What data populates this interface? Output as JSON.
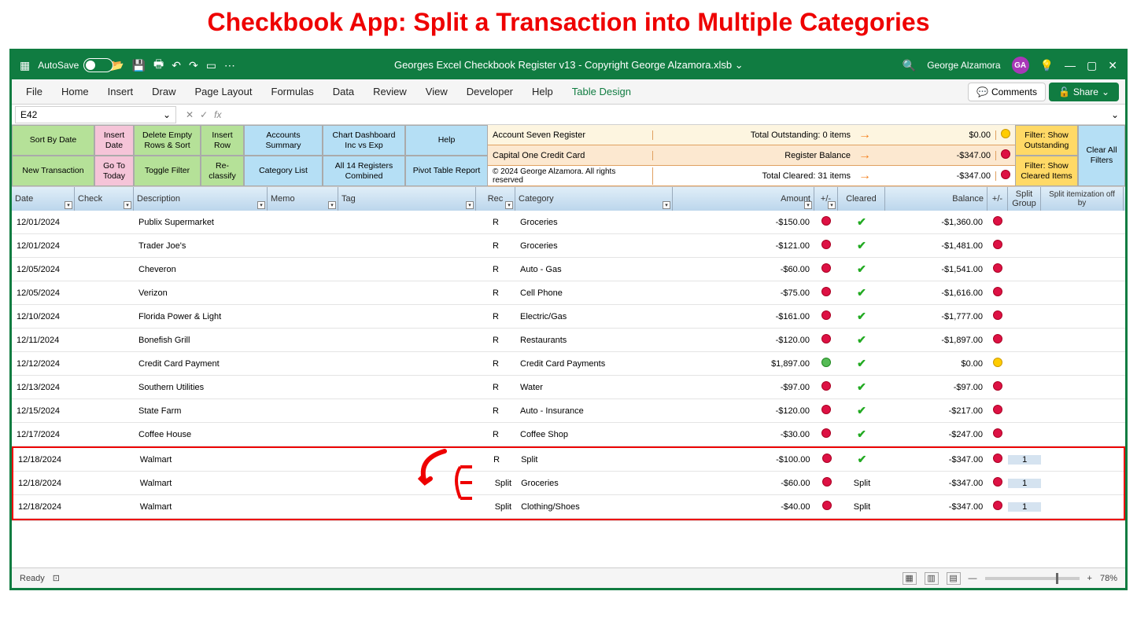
{
  "pageTitle": "Checkbook App: Split a Transaction into Multiple Categories",
  "autoSave": {
    "label": "AutoSave",
    "state": "Off"
  },
  "fileTitle": "Georges Excel Checkbook Register v13 - Copyright George Alzamora.xlsb",
  "user": {
    "name": "George Alzamora",
    "initials": "GA"
  },
  "ribbonTabs": [
    "File",
    "Home",
    "Insert",
    "Draw",
    "Page Layout",
    "Formulas",
    "Data",
    "Review",
    "View",
    "Developer",
    "Help",
    "Table Design"
  ],
  "activeTab": "Table Design",
  "commentsLabel": "Comments",
  "shareLabel": "Share",
  "nameBox": "E42",
  "toolbar": {
    "sortByDate": "Sort By Date",
    "insertDate": "Insert Date",
    "deleteEmpty": "Delete Empty Rows & Sort",
    "insertRow": "Insert Row",
    "accountsSummary": "Accounts Summary",
    "chartDashboard": "Chart Dashboard Inc vs Exp",
    "help": "Help",
    "newTransaction": "New Transaction",
    "goToToday": "Go To Today",
    "toggleFilter": "Toggle Filter",
    "reclassify": "Re-classify",
    "categoryList": "Category List",
    "allRegisters": "All 14 Registers Combined",
    "pivotTable": "Pivot Table Report",
    "filterOutstanding": "Filter: Show Outstanding",
    "filterCleared": "Filter: Show Cleared Items",
    "clearFilters": "Clear All Filters"
  },
  "summary": {
    "row1": {
      "labelA": "Account Seven Register",
      "labelB": "Total Outstanding: 0 items",
      "amount": "$0.00"
    },
    "row2": {
      "labelA": "Capital One Credit Card",
      "labelB": "Register Balance",
      "amount": "-$347.00"
    },
    "row3": {
      "labelA": "© 2024 George Alzamora. All rights reserved",
      "labelB": "Total Cleared: 31 items",
      "amount": "-$347.00"
    }
  },
  "headers": {
    "date": "Date",
    "check": "Check",
    "description": "Description",
    "memo": "Memo",
    "tag": "Tag",
    "rec": "Rec",
    "category": "Category",
    "amount": "Amount",
    "pm": "+/-",
    "cleared": "Cleared",
    "balance": "Balance",
    "pm2": "+/-",
    "splitGroup": "Split Group",
    "splitOff": "Split itemization off by"
  },
  "rows": [
    {
      "date": "12/01/2024",
      "desc": "Publix Supermarket",
      "rec": "R",
      "cat": "Groceries",
      "amount": "-$150.00",
      "pm": "red",
      "cleared": "check",
      "balance": "-$1,360.00",
      "pm2": "red",
      "split": "",
      "hl": false
    },
    {
      "date": "12/01/2024",
      "desc": "Trader Joe's",
      "rec": "R",
      "cat": "Groceries",
      "amount": "-$121.00",
      "pm": "red",
      "cleared": "check",
      "balance": "-$1,481.00",
      "pm2": "red",
      "split": "",
      "hl": false
    },
    {
      "date": "12/05/2024",
      "desc": "Cheveron",
      "rec": "R",
      "cat": "Auto - Gas",
      "amount": "-$60.00",
      "pm": "red",
      "cleared": "check",
      "balance": "-$1,541.00",
      "pm2": "red",
      "split": "",
      "hl": false
    },
    {
      "date": "12/05/2024",
      "desc": "Verizon",
      "rec": "R",
      "cat": "Cell Phone",
      "amount": "-$75.00",
      "pm": "red",
      "cleared": "check",
      "balance": "-$1,616.00",
      "pm2": "red",
      "split": "",
      "hl": false
    },
    {
      "date": "12/10/2024",
      "desc": "Florida Power & Light",
      "rec": "R",
      "cat": "Electric/Gas",
      "amount": "-$161.00",
      "pm": "red",
      "cleared": "check",
      "balance": "-$1,777.00",
      "pm2": "red",
      "split": "",
      "hl": false
    },
    {
      "date": "12/11/2024",
      "desc": "Bonefish Grill",
      "rec": "R",
      "cat": "Restaurants",
      "amount": "-$120.00",
      "pm": "red",
      "cleared": "check",
      "balance": "-$1,897.00",
      "pm2": "red",
      "split": "",
      "hl": false
    },
    {
      "date": "12/12/2024",
      "desc": "Credit Card Payment",
      "rec": "R",
      "cat": "Credit Card Payments",
      "amount": "$1,897.00",
      "pm": "green",
      "cleared": "check",
      "balance": "$0.00",
      "pm2": "orange",
      "split": "",
      "hl": false
    },
    {
      "date": "12/13/2024",
      "desc": "Southern Utilities",
      "rec": "R",
      "cat": "Water",
      "amount": "-$97.00",
      "pm": "red",
      "cleared": "check",
      "balance": "-$97.00",
      "pm2": "red",
      "split": "",
      "hl": false
    },
    {
      "date": "12/15/2024",
      "desc": "State Farm",
      "rec": "R",
      "cat": "Auto - Insurance",
      "amount": "-$120.00",
      "pm": "red",
      "cleared": "check",
      "balance": "-$217.00",
      "pm2": "red",
      "split": "",
      "hl": false
    },
    {
      "date": "12/17/2024",
      "desc": "Coffee House",
      "rec": "R",
      "cat": "Coffee Shop",
      "amount": "-$30.00",
      "pm": "red",
      "cleared": "check",
      "balance": "-$247.00",
      "pm2": "red",
      "split": "",
      "hl": false
    },
    {
      "date": "12/18/2024",
      "desc": "Walmart",
      "rec": "R",
      "cat": "Split",
      "amount": "-$100.00",
      "pm": "red",
      "cleared": "check",
      "balance": "-$347.00",
      "pm2": "red",
      "split": "1",
      "hl": true
    },
    {
      "date": "12/18/2024",
      "desc": "Walmart",
      "rec": "Split",
      "cat": "Groceries",
      "amount": "-$60.00",
      "pm": "red",
      "cleared": "Split",
      "balance": "-$347.00",
      "pm2": "red",
      "split": "1",
      "hl": true
    },
    {
      "date": "12/18/2024",
      "desc": "Walmart",
      "rec": "Split",
      "cat": "Clothing/Shoes",
      "amount": "-$40.00",
      "pm": "red",
      "cleared": "Split",
      "balance": "-$347.00",
      "pm2": "red",
      "split": "1",
      "hl": true
    }
  ],
  "statusBar": {
    "ready": "Ready",
    "zoom": "78%"
  }
}
